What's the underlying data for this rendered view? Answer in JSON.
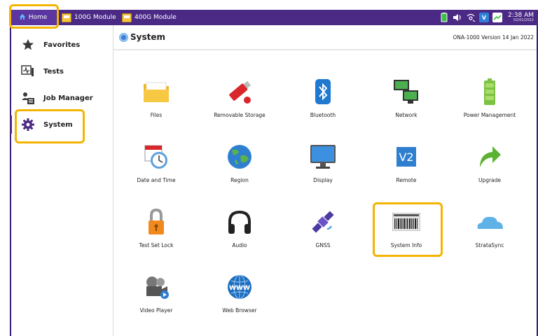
{
  "topbar": {
    "tabs": [
      {
        "label": "Home",
        "icon": "home-icon"
      },
      {
        "label": "100G Module",
        "icon": "module-icon"
      },
      {
        "label": "400G Module",
        "icon": "module-icon"
      }
    ],
    "status": {
      "icons": [
        "battery-icon",
        "speaker-icon",
        "signal-icon",
        "vnc-icon",
        "network-icon"
      ],
      "time": "2:38 AM",
      "date": "02/01/2022"
    }
  },
  "sidebar": {
    "items": [
      {
        "label": "Favorites",
        "icon": "star-icon"
      },
      {
        "label": "Tests",
        "icon": "tests-icon"
      },
      {
        "label": "Job Manager",
        "icon": "job-manager-icon"
      },
      {
        "label": "System",
        "icon": "gear-icon",
        "active": true
      }
    ]
  },
  "content": {
    "title": "System",
    "version": "ONA-1000 Version 14 Jan 2022",
    "apps": [
      {
        "label": "Files",
        "icon": "folder-icon"
      },
      {
        "label": "Removable Storage",
        "icon": "usb-drive-icon"
      },
      {
        "label": "Bluetooth",
        "icon": "bluetooth-icon"
      },
      {
        "label": "Network",
        "icon": "network-computers-icon"
      },
      {
        "label": "Power Management",
        "icon": "battery-icon"
      },
      {
        "label": "Date and Time",
        "icon": "calendar-clock-icon"
      },
      {
        "label": "Region",
        "icon": "globe-icon"
      },
      {
        "label": "Display",
        "icon": "monitor-icon"
      },
      {
        "label": "Remote",
        "icon": "vnc-icon"
      },
      {
        "label": "Upgrade",
        "icon": "upgrade-arrow-icon"
      },
      {
        "label": "Test Set Lock",
        "icon": "lock-icon"
      },
      {
        "label": "Audio",
        "icon": "headphones-icon"
      },
      {
        "label": "GNSS",
        "icon": "satellite-icon"
      },
      {
        "label": "System Info",
        "icon": "barcode-icon"
      },
      {
        "label": "StrataSync",
        "icon": "cloud-icon"
      },
      {
        "label": "Video Player",
        "icon": "video-player-icon"
      },
      {
        "label": "Web Browser",
        "icon": "web-globe-icon"
      }
    ]
  },
  "colors": {
    "topbar": "#4b2a86",
    "highlight": "#f5b400",
    "accent_purple": "#4b2a86"
  }
}
